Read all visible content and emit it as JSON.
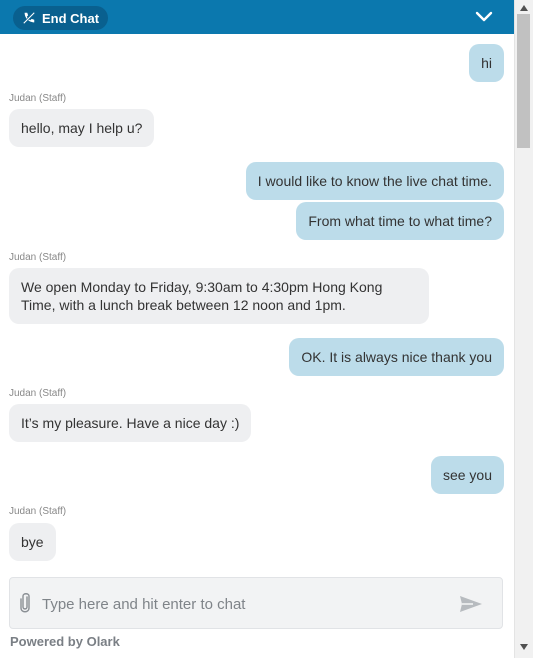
{
  "header": {
    "end_chat_label": "End Chat",
    "end_chat_icon": "phone-hangup-icon",
    "collapse_icon": "chevron-down-icon",
    "background_color": "#0b78ae"
  },
  "messages": [
    {
      "from": "visitor",
      "text": "hi"
    },
    {
      "from": "operator",
      "sender": "Judan (Staff)",
      "text": "hello, may I help u?"
    },
    {
      "from": "visitor",
      "text": "I would like to know the live chat time."
    },
    {
      "from": "visitor",
      "text": "From what time to what time?"
    },
    {
      "from": "operator",
      "sender": "Judan (Staff)",
      "text": "We open Monday to Friday, 9:30am to 4:30pm Hong Kong Time, with a lunch break between 12 noon and 1pm."
    },
    {
      "from": "visitor",
      "text": "OK. It is always nice thank you"
    },
    {
      "from": "operator",
      "sender": "Judan (Staff)",
      "text": "It’s my pleasure. Have a nice day :)"
    },
    {
      "from": "visitor",
      "text": "see you"
    },
    {
      "from": "operator",
      "sender": "Judan (Staff)",
      "text": "bye"
    }
  ],
  "composer": {
    "placeholder": "Type here and hit enter to chat",
    "attach_icon": "paperclip-icon",
    "send_icon": "send-icon"
  },
  "footer": {
    "powered_by": "Powered by Olark"
  },
  "colors": {
    "visitor_bubble": "#bcdcea",
    "operator_bubble": "#eeeff1"
  }
}
